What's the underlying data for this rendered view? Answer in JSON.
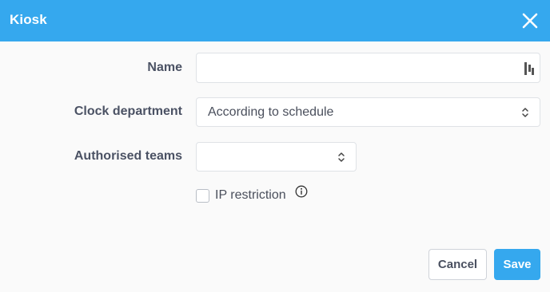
{
  "header": {
    "title": "Kiosk",
    "close_icon": "close-icon"
  },
  "form": {
    "name": {
      "label": "Name",
      "value": "",
      "placeholder": "",
      "icon": "password-manager-icon"
    },
    "clock_department": {
      "label": "Clock department",
      "value": "According to schedule"
    },
    "authorised_teams": {
      "label": "Authorised teams",
      "value": ""
    },
    "ip_restriction": {
      "label": "IP restriction",
      "checked": false,
      "info_icon": "info-icon"
    }
  },
  "footer": {
    "cancel_label": "Cancel",
    "save_label": "Save"
  },
  "colors": {
    "accent": "#35a8ee",
    "text": "#4b5264",
    "border": "#dfe2e6",
    "background": "#fafafa"
  }
}
